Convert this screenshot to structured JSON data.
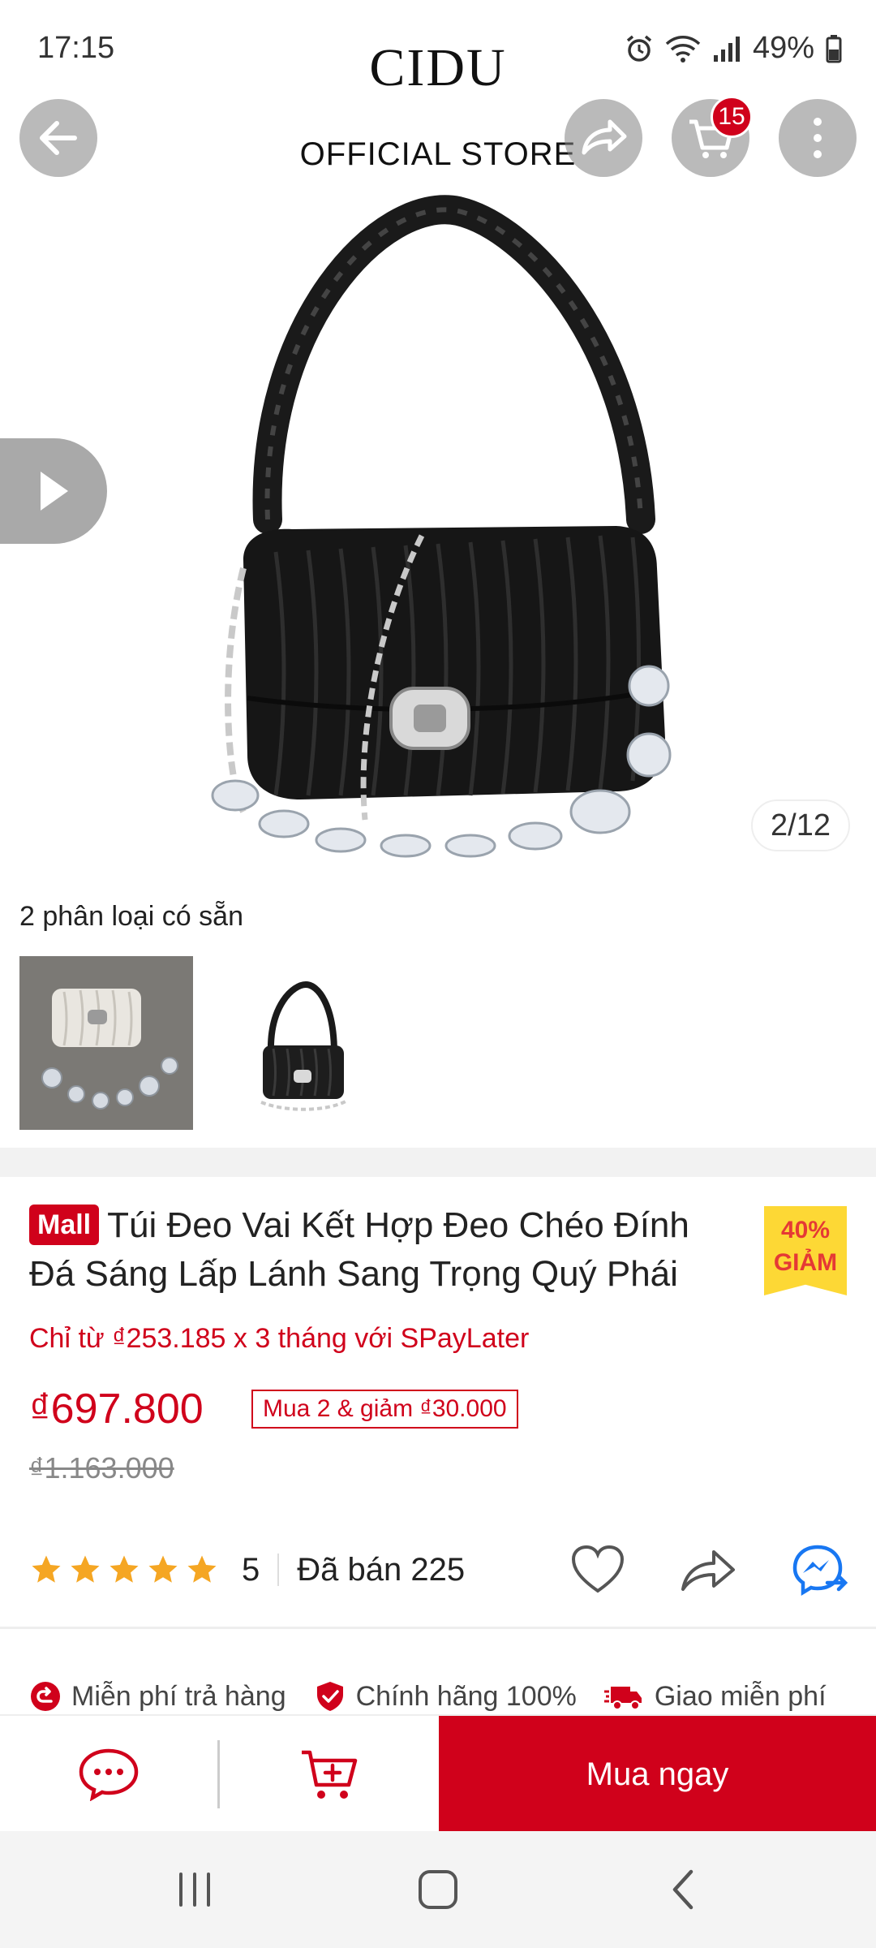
{
  "status_bar": {
    "time": "17:15",
    "battery": "49%"
  },
  "header": {
    "brand_logo": "CIDU",
    "brand_subtitle": "OFFICIAL STORE",
    "cart_count": "15",
    "image_counter": "2/12"
  },
  "variants": {
    "title": "2 phân loại có sẵn",
    "items": [
      {
        "name": "white-bag",
        "color": "#e9e6e0"
      },
      {
        "name": "black-bag",
        "color": "#1d1d1d"
      }
    ]
  },
  "product": {
    "mall_badge": "Mall",
    "title": "Túi Đeo Vai Kết Hợp Đeo Chéo Đính Đá Sáng Lấp Lánh Sang Trọng Quý Phái",
    "discount_percent": "40%",
    "discount_label": "GIẢM",
    "spaylater_text": "Chỉ từ ₫253.185 x 3 tháng với SPayLater",
    "price": "₫697.800",
    "promo_tag": "Mua 2 & giảm ₫30.000",
    "old_price": "₫1.163.000",
    "rating": 5,
    "rating_value": "5",
    "sold_text": "Đã bán 225"
  },
  "guarantees": [
    {
      "icon": "return-icon",
      "label": "Miễn phí trả hàng"
    },
    {
      "icon": "shield-check-icon",
      "label": "Chính hãng 100%"
    },
    {
      "icon": "delivery-truck-icon",
      "label": "Giao miễn phí"
    }
  ],
  "bottom_bar": {
    "buy_now_label": "Mua ngay"
  },
  "colors": {
    "accent": "#d0011b",
    "star": "#f5a623",
    "discount_bg": "#fdd835",
    "messenger": "#1877f2"
  }
}
